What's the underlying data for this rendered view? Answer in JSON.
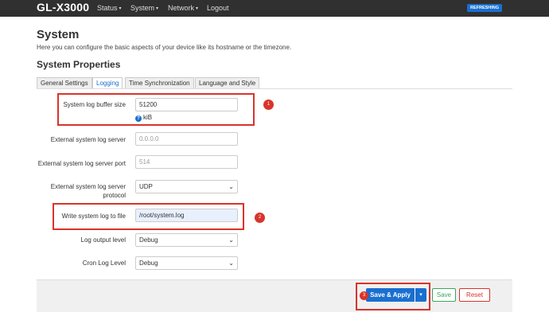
{
  "brand": "GL-X3000",
  "nav": [
    {
      "label": "Status",
      "caret": "▾"
    },
    {
      "label": "System",
      "caret": "▾"
    },
    {
      "label": "Network",
      "caret": "▾"
    },
    {
      "label": "Logout",
      "caret": ""
    }
  ],
  "refresh_badge": "REFRESHING",
  "page": {
    "title": "System",
    "description": "Here you can configure the basic aspects of your device like its hostname or the timezone.",
    "section": "System Properties"
  },
  "tabs": [
    {
      "label": "General Settings",
      "active": false
    },
    {
      "label": "Logging",
      "active": true
    },
    {
      "label": "Time Synchronization",
      "active": false
    },
    {
      "label": "Language and Style",
      "active": false
    }
  ],
  "fields": {
    "log_buffer_size": {
      "label": "System log buffer size",
      "value": "51200",
      "unit": "kiB",
      "help_icon": "question-circle-icon"
    },
    "external_log_server": {
      "label": "External system log server",
      "placeholder": "0.0.0.0"
    },
    "external_log_server_port": {
      "label": "External system log server port",
      "placeholder": "514"
    },
    "external_log_server_protocol": {
      "label_line1": "External system log server",
      "label_line2": "protocol",
      "value": "UDP"
    },
    "write_log_to_file": {
      "label": "Write system log to file",
      "value": "/root/system.log"
    },
    "log_output_level": {
      "label": "Log output level",
      "value": "Debug"
    },
    "cron_log_level": {
      "label": "Cron Log Level",
      "value": "Debug"
    }
  },
  "markers": [
    "1",
    "2",
    "3"
  ],
  "buttons": {
    "save_apply": "Save & Apply",
    "save": "Save",
    "reset": "Reset"
  },
  "colors": {
    "navbar": "#303030",
    "accent": "#1a6fd0",
    "highlight": "#d9342b",
    "save": "#39a85d"
  }
}
